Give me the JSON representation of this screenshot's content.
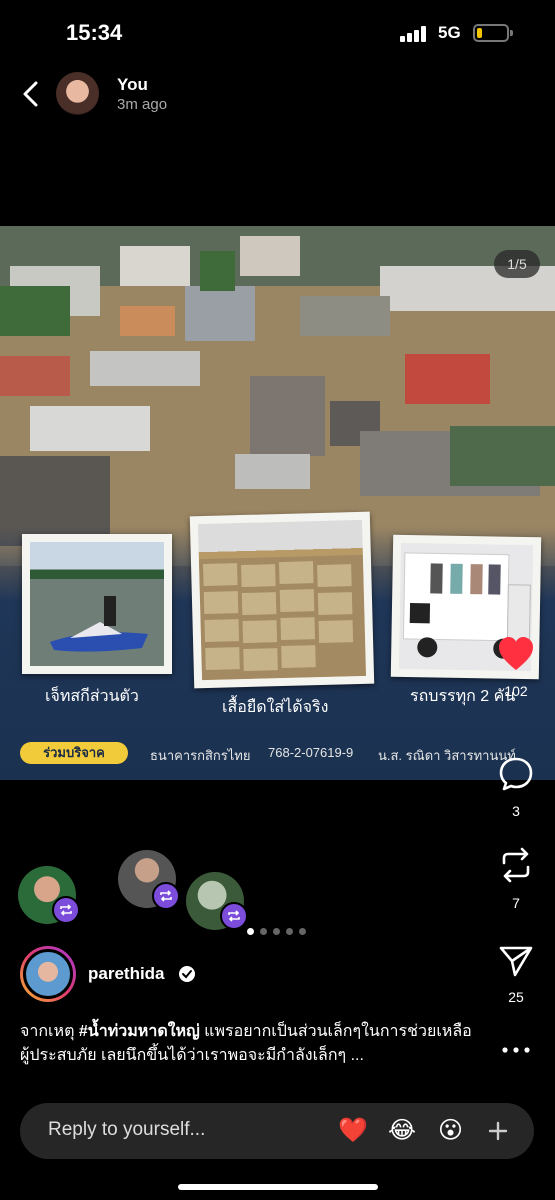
{
  "status_bar": {
    "time": "15:34",
    "network": "5G"
  },
  "header": {
    "user_name": "You",
    "time_ago": "3m ago"
  },
  "media": {
    "page_counter": "1/5",
    "captions": [
      "เจ็ทสกีส่วนตัว",
      "เสื้อยืดใส่ได้จริง",
      "รถบรรทุก 2 คัน"
    ],
    "donate_badge": "ร่วมบริจาค",
    "donate_bank": "ธนาคารกสิกรไทย",
    "donate_account": "768-2-07619-9",
    "donate_name": "น.ส. รณิดา วิสารทานนท์"
  },
  "rail": {
    "likes": "102",
    "comments": "3",
    "reposts": "7",
    "shares": "25"
  },
  "post": {
    "author": "parethida",
    "text_prefix": "จากเหตุ ",
    "hashtag": "#น้ำท่วมหาดใหญ่",
    "text_rest": " แพรอยากเป็นส่วนเล็กๆในการช่วยเหลือผู้ประสบภัย เลยนึกขึ้นได้ว่าเราพอจะมีกำลังเล็กๆ ..."
  },
  "reply_bar": {
    "placeholder": "Reply to yourself...",
    "emojis": [
      "❤️",
      "😂",
      "😮"
    ]
  },
  "colors": {
    "like": "#ff3040",
    "repost_badge": "#7c4ddb",
    "donate_badge": "#f2cb3a",
    "banner": "#1f3658"
  }
}
